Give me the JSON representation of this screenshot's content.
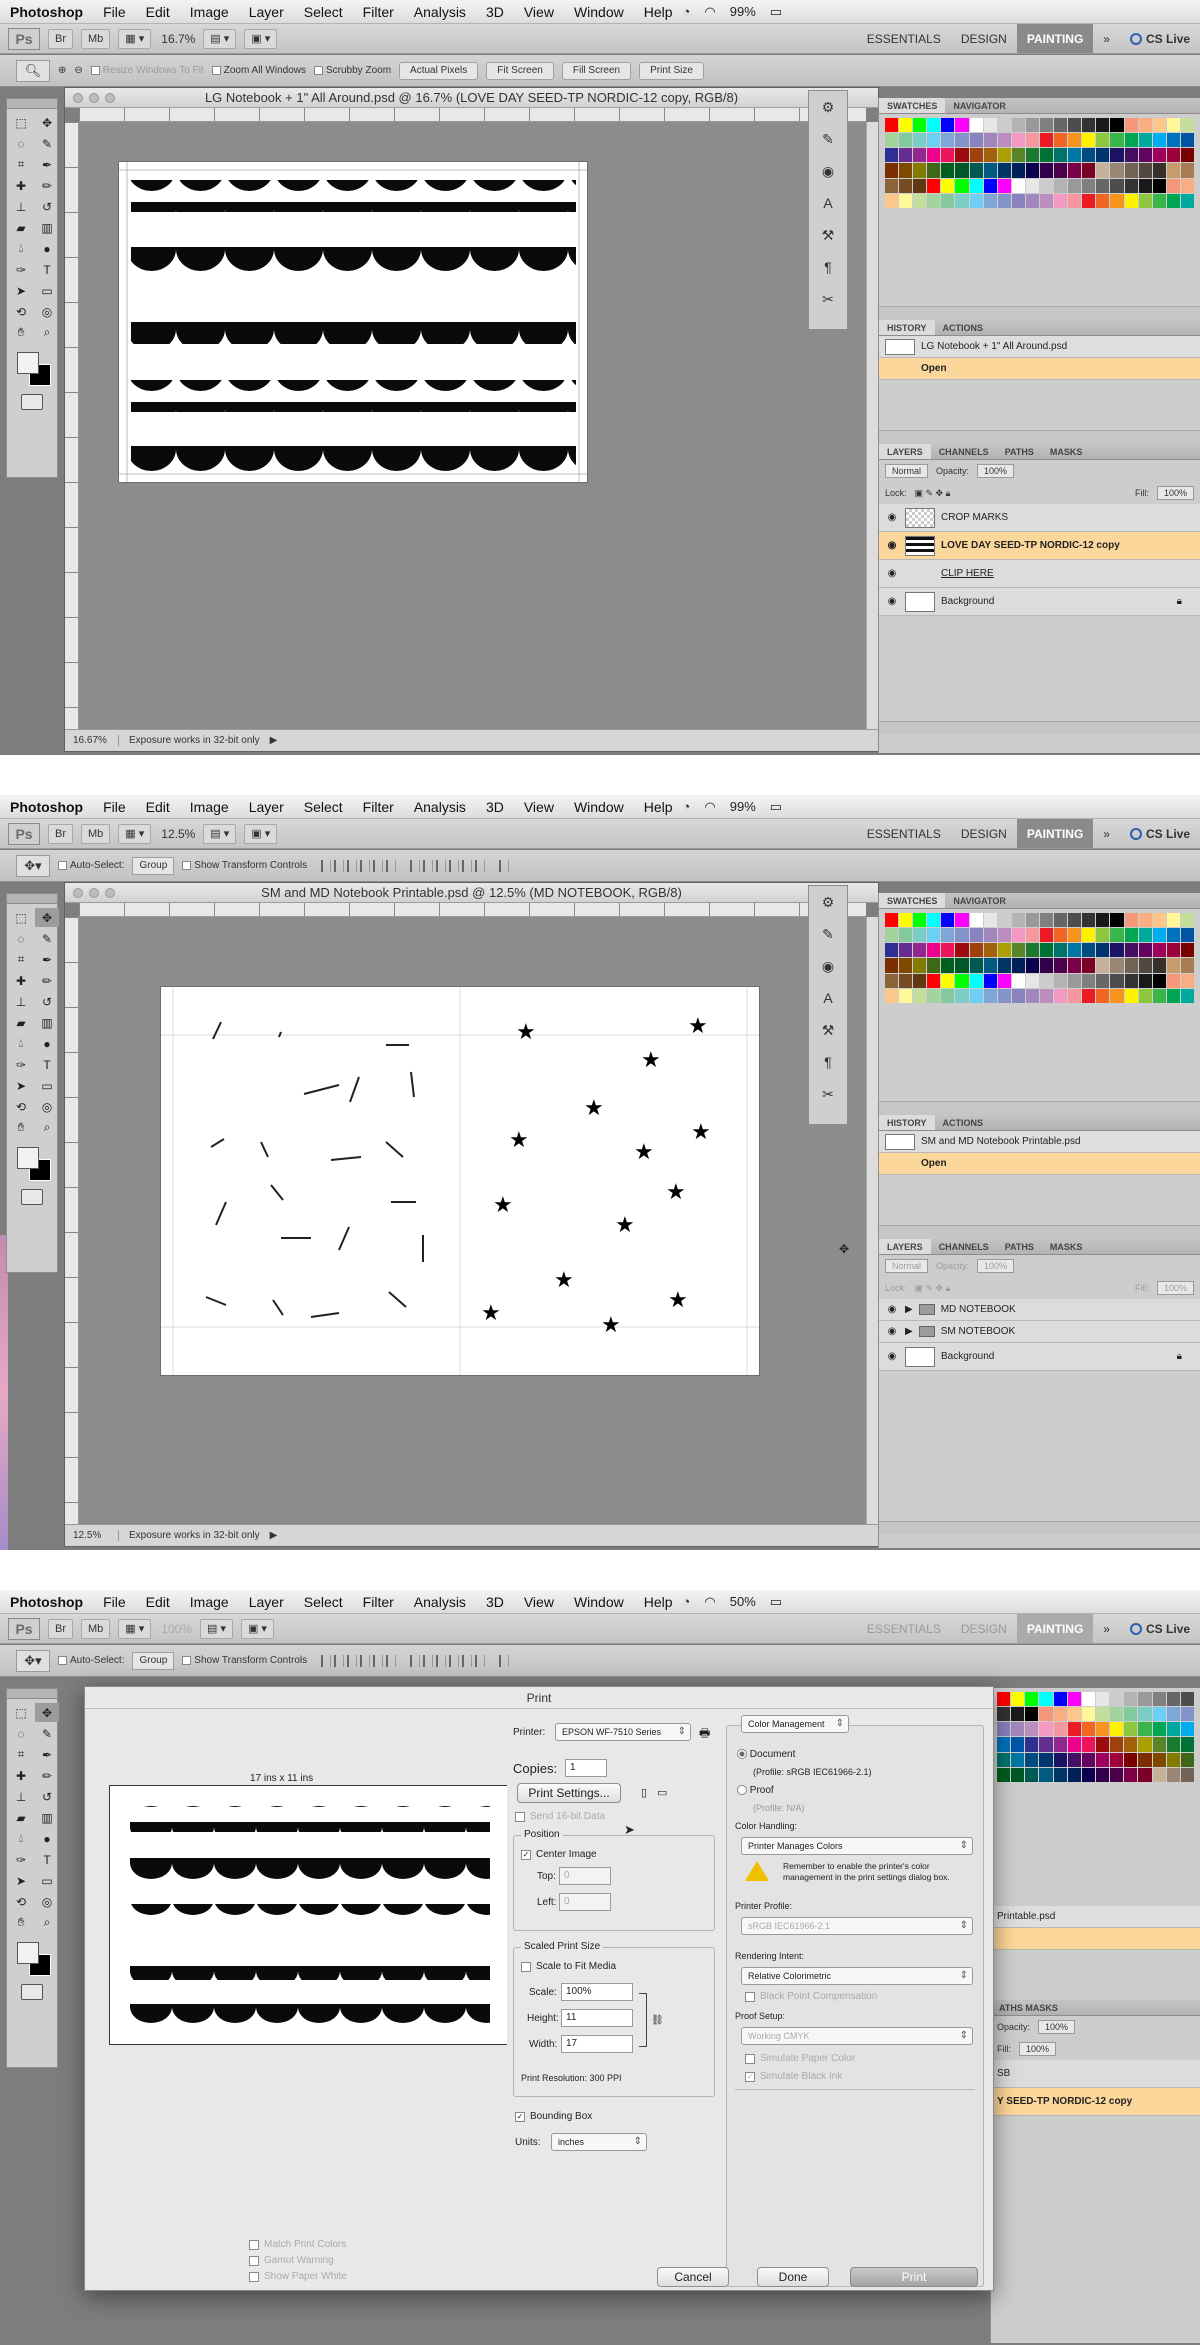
{
  "menubar": {
    "app": "Photoshop",
    "items": [
      "File",
      "Edit",
      "Image",
      "Layer",
      "Select",
      "Filter",
      "Analysis",
      "3D",
      "View",
      "Window",
      "Help"
    ]
  },
  "workspace": {
    "essentials": "ESSENTIALS",
    "design": "DESIGN",
    "painting": "PAINTING",
    "cslive": "CS Live"
  },
  "shots": [
    {
      "battery": "99%",
      "zoom": "16.7%",
      "options": {
        "resize": "Resize Windows To Fit",
        "zoom_all": "Zoom All Windows",
        "scrubby": "Scrubby Zoom",
        "actual": "Actual Pixels",
        "fit": "Fit Screen",
        "fill": "Fill Screen",
        "print": "Print Size"
      },
      "doc_title": "LG Notebook + 1\" All Around.psd @ 16.7% (LOVE DAY SEED-TP NORDIC-12 copy, RGB/8)",
      "status_zoom": "16.67%",
      "status_text": "Exposure works in 32-bit only",
      "history": {
        "tabs": [
          "HISTORY",
          "ACTIONS"
        ],
        "snapshot": "LG Notebook + 1\" All Around.psd",
        "step": "Open"
      },
      "layers": {
        "tabs": [
          "LAYERS",
          "CHANNELS",
          "PATHS",
          "MASKS"
        ],
        "blend": "Normal",
        "opacity_label": "Opacity:",
        "opacity": "100%",
        "lock_label": "Lock:",
        "fill_label": "Fill:",
        "fill": "100%",
        "items": [
          "CROP MARKS",
          "LOVE DAY SEED-TP NORDIC-12 copy",
          "CLIP HERE",
          "Background"
        ]
      },
      "swatch_tabs": [
        "SWATCHES",
        "NAVIGATOR"
      ]
    },
    {
      "battery": "99%",
      "zoom": "12.5%",
      "options": {
        "auto_select": "Auto-Select:",
        "group": "Group",
        "transform": "Show Transform Controls"
      },
      "doc_title": "SM and MD Notebook Printable.psd @ 12.5% (MD NOTEBOOK, RGB/8)",
      "status_zoom": "12.5%",
      "status_text": "Exposure works in 32-bit only",
      "history": {
        "tabs": [
          "HISTORY",
          "ACTIONS"
        ],
        "snapshot": "SM and MD Notebook Printable.psd",
        "step": "Open"
      },
      "layers": {
        "tabs": [
          "LAYERS",
          "CHANNELS",
          "PATHS",
          "MASKS"
        ],
        "blend": "Normal",
        "opacity_label": "Opacity:",
        "opacity": "100%",
        "lock_label": "Lock:",
        "fill_label": "Fill:",
        "fill": "100%",
        "items": [
          "MD NOTEBOOK",
          "SM NOTEBOOK",
          "Background"
        ]
      },
      "swatch_tabs": [
        "SWATCHES",
        "NAVIGATOR"
      ]
    },
    {
      "battery": "50%",
      "zoom": "100%",
      "options": {
        "auto_select": "Auto-Select:",
        "group": "Group",
        "transform": "Show Transform Controls"
      },
      "layers_peek": {
        "opacity_label": "Opacity:",
        "opacity": "100%",
        "fill_label": "Fill:",
        "fill": "100%",
        "partial_doc": "Printable.psd",
        "partial_layer_a": "SB",
        "partial_layer_b": "Y SEED-TP NORDIC-12 copy",
        "tabs": "ATHS   MASKS"
      }
    }
  ],
  "print_dialog": {
    "title": "Print",
    "paper_size": "17 ins x 11 ins",
    "printer_label": "Printer:",
    "printer": "EPSON WF-7510 Series",
    "copies_label": "Copies:",
    "copies": "1",
    "print_settings": "Print Settings...",
    "send16": "Send 16-bit Data",
    "position_title": "Position",
    "center_image": "Center Image",
    "top_label": "Top:",
    "top": "0",
    "left_label": "Left:",
    "left": "0",
    "scaled_title": "Scaled Print Size",
    "scale_to_fit": "Scale to Fit Media",
    "scale_label": "Scale:",
    "scale": "100%",
    "height_label": "Height:",
    "height": "11",
    "width_label": "Width:",
    "width": "17",
    "resolution": "Print Resolution: 300 PPI",
    "bounding_box": "Bounding Box",
    "units_label": "Units:",
    "units": "inches",
    "match_colors": "Match Print Colors",
    "gamut": "Gamut Warning",
    "paper_white": "Show Paper White",
    "color_mgmt": "Color Management",
    "document": "Document",
    "document_profile": "(Profile: sRGB IEC61966-2.1)",
    "proof": "Proof",
    "proof_profile": "(Profile: N/A)",
    "color_handling_label": "Color Handling:",
    "color_handling": "Printer Manages Colors",
    "warning": "Remember to enable the printer's color management in the print settings dialog box.",
    "printer_profile_label": "Printer Profile:",
    "printer_profile": "sRGB IEC61966-2.1",
    "rendering_label": "Rendering Intent:",
    "rendering": "Relative Colorimetric",
    "black_point": "Black Point Compensation",
    "proof_setup_label": "Proof Setup:",
    "proof_setup": "Working CMYK",
    "sim_paper": "Simulate Paper Color",
    "sim_black": "Simulate Black Ink",
    "cancel": "Cancel",
    "done": "Done",
    "print": "Print"
  }
}
